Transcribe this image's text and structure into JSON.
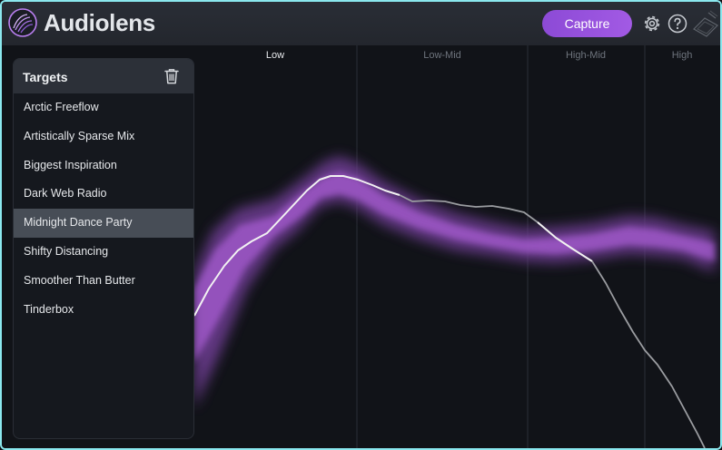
{
  "header": {
    "app_title": "Audiolens",
    "capture_label": "Capture",
    "icons": [
      "audiolens-logo-icon",
      "gear-icon",
      "help-icon",
      "plugin-mark-icon"
    ],
    "accent_color": "#9a52df",
    "border_color": "#8be8ee"
  },
  "bands": {
    "active": "Low",
    "labels": [
      "Low",
      "Low-Mid",
      "High-Mid",
      "High"
    ]
  },
  "targets": {
    "title": "Targets",
    "delete_icon": "trash-icon",
    "selected": "Midnight Dance Party",
    "items": [
      "Arctic Freeflow",
      "Artistically Sparse Mix",
      "Biggest Inspiration",
      "Dark Web Radio",
      "Midnight Dance Party",
      "Shifty Distancing",
      "Smoother Than Butter",
      "Tinderbox"
    ]
  },
  "colors": {
    "target_band": "#a055c8",
    "captured_curve": "#f2f2f2",
    "captured_curve_dim": "#9a9ca0"
  }
}
